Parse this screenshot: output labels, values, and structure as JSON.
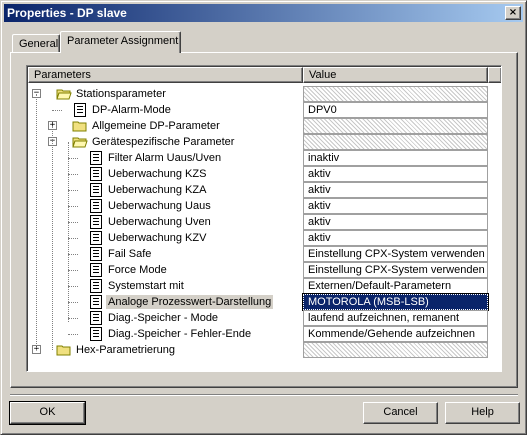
{
  "window": {
    "title": "Properties - DP slave",
    "close_glyph": "×"
  },
  "tabs": [
    {
      "label": "General",
      "active": false
    },
    {
      "label": "Parameter Assignment",
      "active": true
    }
  ],
  "grid": {
    "columns": [
      "Parameters",
      "Value"
    ],
    "rows": [
      {
        "label": "Stationsparameter",
        "value": "",
        "depth": 0,
        "icon": "folder-open-icon",
        "expander": "−",
        "selected": false
      },
      {
        "label": "DP-Alarm-Mode",
        "value": "DPV0",
        "depth": 1,
        "icon": "parameter-icon",
        "expander": "",
        "selected": false
      },
      {
        "label": "Allgemeine DP-Parameter",
        "value": "",
        "depth": 1,
        "icon": "folder-icon",
        "expander": "+",
        "selected": false
      },
      {
        "label": "Gerätespezifische Parameter",
        "value": "",
        "depth": 1,
        "icon": "folder-open-icon",
        "expander": "−",
        "selected": false
      },
      {
        "label": "Filter Alarm Uaus/Uven",
        "value": "inaktiv",
        "depth": 2,
        "icon": "parameter-icon",
        "expander": "",
        "selected": false
      },
      {
        "label": "Ueberwachung KZS",
        "value": "aktiv",
        "depth": 2,
        "icon": "parameter-icon",
        "expander": "",
        "selected": false
      },
      {
        "label": "Ueberwachung KZA",
        "value": "aktiv",
        "depth": 2,
        "icon": "parameter-icon",
        "expander": "",
        "selected": false
      },
      {
        "label": "Ueberwachung Uaus",
        "value": "aktiv",
        "depth": 2,
        "icon": "parameter-icon",
        "expander": "",
        "selected": false
      },
      {
        "label": "Ueberwachung Uven",
        "value": "aktiv",
        "depth": 2,
        "icon": "parameter-icon",
        "expander": "",
        "selected": false
      },
      {
        "label": "Ueberwachung KZV",
        "value": "aktiv",
        "depth": 2,
        "icon": "parameter-icon",
        "expander": "",
        "selected": false
      },
      {
        "label": "Fail Safe",
        "value": "Einstellung CPX-System verwenden",
        "depth": 2,
        "icon": "parameter-icon",
        "expander": "",
        "selected": false
      },
      {
        "label": "Force Mode",
        "value": "Einstellung CPX-System verwenden",
        "depth": 2,
        "icon": "parameter-icon",
        "expander": "",
        "selected": false
      },
      {
        "label": "Systemstart mit",
        "value": "Externen/Default-Parametern",
        "depth": 2,
        "icon": "parameter-icon",
        "expander": "",
        "selected": false
      },
      {
        "label": "Analoge Prozesswert-Darstellung",
        "value": "MOTOROLA (MSB-LSB)",
        "depth": 2,
        "icon": "parameter-icon",
        "expander": "",
        "selected": true
      },
      {
        "label": "Diag.-Speicher - Mode",
        "value": "laufend aufzeichnen, remanent",
        "depth": 2,
        "icon": "parameter-icon",
        "expander": "",
        "selected": false
      },
      {
        "label": "Diag.-Speicher - Fehler-Ende",
        "value": "Kommende/Gehende aufzeichnen",
        "depth": 2,
        "icon": "parameter-icon",
        "expander": "",
        "selected": false
      },
      {
        "label": "Hex-Parametrierung",
        "value": "",
        "depth": 0,
        "icon": "folder-icon",
        "expander": "+",
        "selected": false
      }
    ]
  },
  "buttons": {
    "ok": "OK",
    "cancel": "Cancel",
    "help": "Help"
  }
}
